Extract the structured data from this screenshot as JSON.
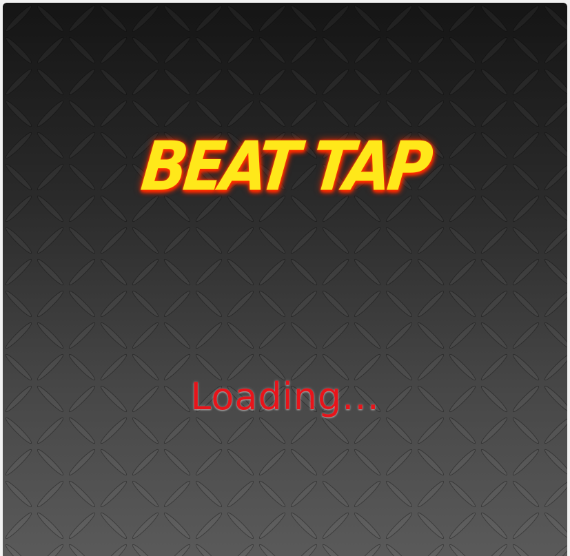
{
  "game": {
    "title": "BEAT TAP",
    "status_text": "Loading..."
  },
  "colors": {
    "title_fill": "#ffe81a",
    "title_glow": "#ff3300",
    "loading_text": "#e8141a",
    "background_top": "#151515",
    "background_bottom": "#5a5a5a"
  },
  "background": {
    "texture": "diamond-plate-metal"
  }
}
